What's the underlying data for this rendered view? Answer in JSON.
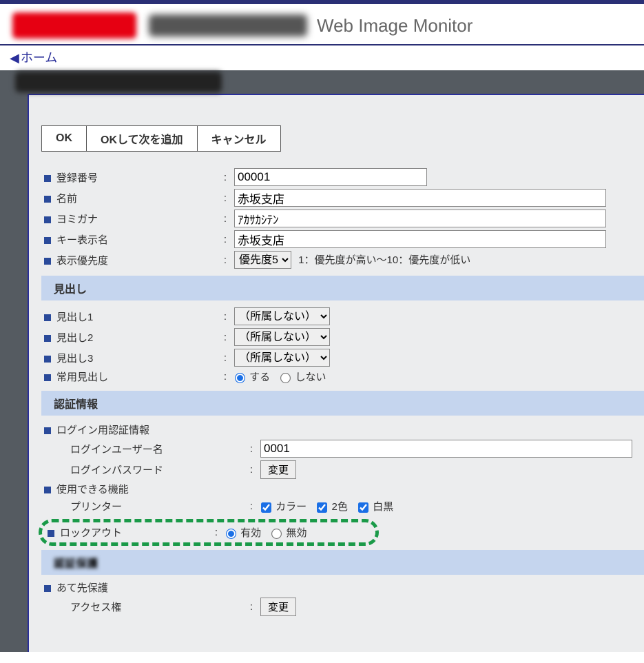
{
  "app_title": "Web Image Monitor",
  "breadcrumb": {
    "home": "ホーム"
  },
  "buttons": {
    "ok": "OK",
    "ok_add_next": "OKして次を追加",
    "cancel": "キャンセル",
    "change": "変更"
  },
  "fields": {
    "reg_no": {
      "label": "登録番号",
      "value": "00001"
    },
    "name": {
      "label": "名前",
      "value": "赤坂支店"
    },
    "yomigana": {
      "label": "ヨミガナ",
      "value": "ｱｶｻｶｼﾃﾝ"
    },
    "key_display_name": {
      "label": "キー表示名",
      "value": "赤坂支店"
    },
    "priority": {
      "label": "表示優先度",
      "selected": "優先度5",
      "note": "1：優先度が高い〜10：優先度が低い"
    }
  },
  "sections": {
    "heading": "見出し",
    "auth": "認証情報",
    "auth_protect": "認証保護"
  },
  "heading": {
    "h1": {
      "label": "見出し1",
      "selected": "（所属しない）"
    },
    "h2": {
      "label": "見出し2",
      "selected": "（所属しない）"
    },
    "h3": {
      "label": "見出し3",
      "selected": "（所属しない）"
    },
    "common": {
      "label": "常用見出し",
      "yes": "する",
      "no": "しない"
    }
  },
  "auth": {
    "login_info_label": "ログイン用認証情報",
    "login_user_label": "ログインユーザー名",
    "login_user_value": "0001",
    "login_pw_label": "ログインパスワード",
    "features_label": "使用できる機能",
    "printer_label": "プリンター",
    "printer_opts": {
      "color": "カラー",
      "twocolor": "2色",
      "bw": "白黒"
    },
    "lockout": {
      "label": "ロックアウト",
      "enabled": "有効",
      "disabled": "無効"
    }
  },
  "dest_protect": {
    "label": "あて先保護",
    "access_label": "アクセス権"
  }
}
